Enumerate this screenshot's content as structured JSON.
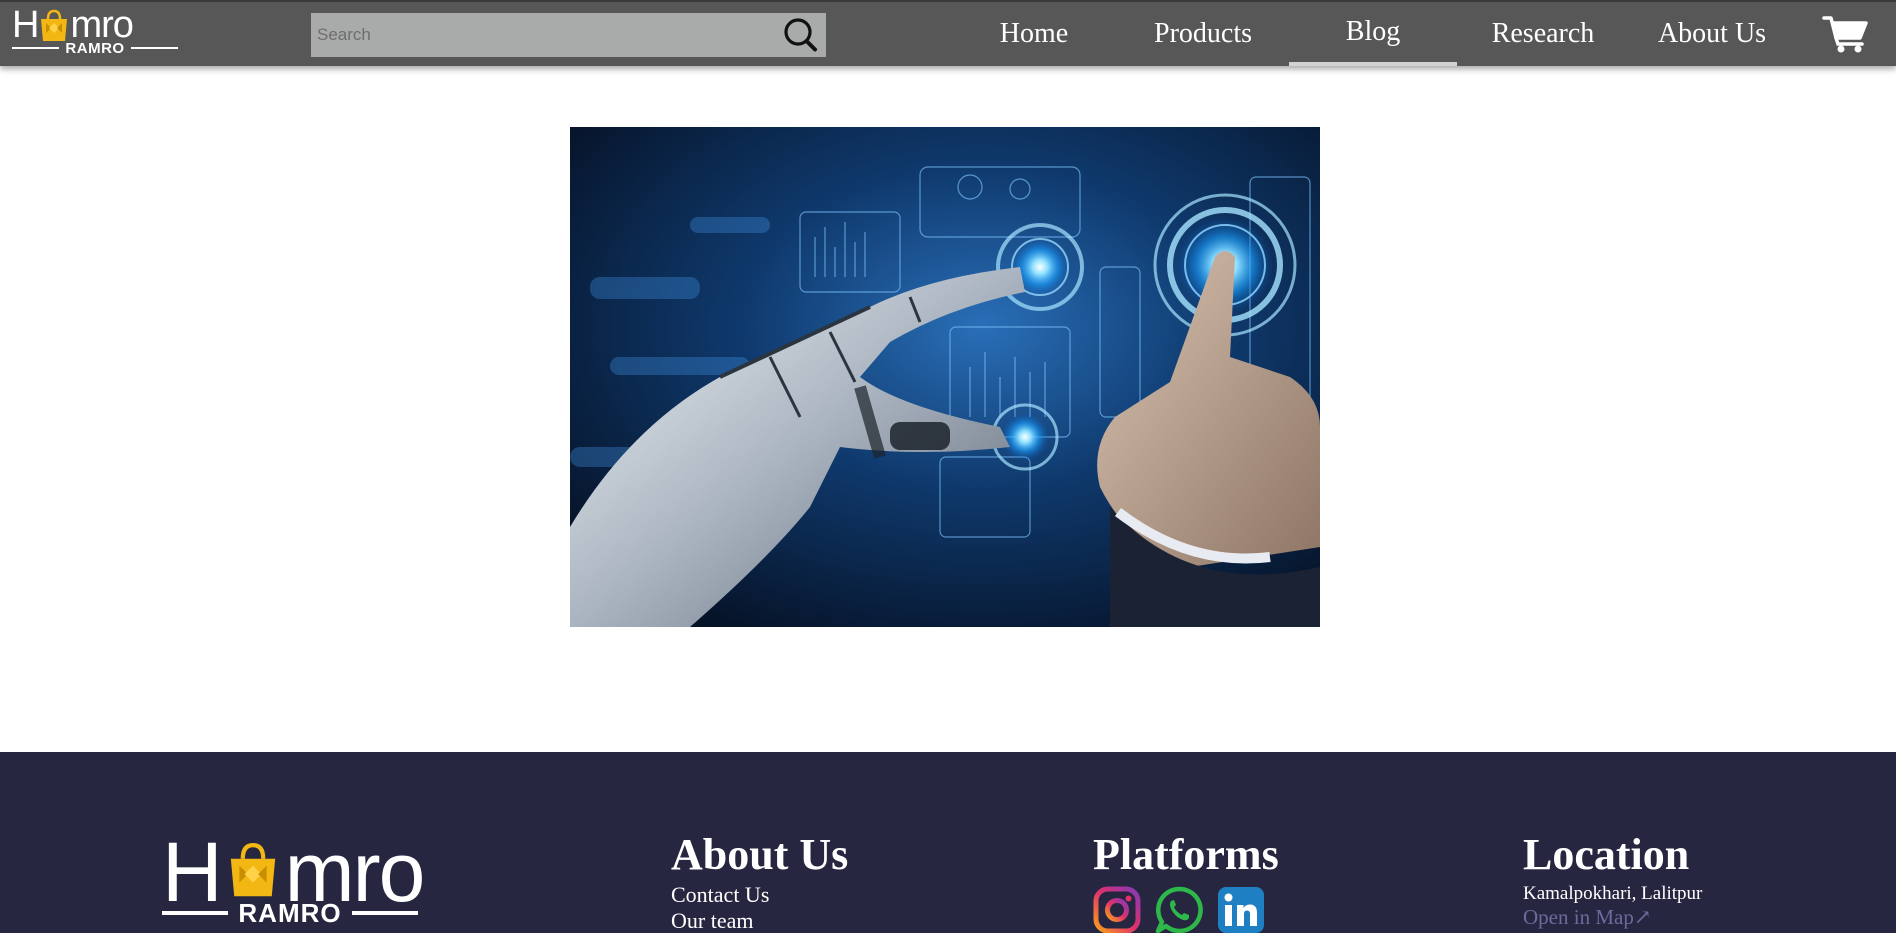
{
  "brand": {
    "logo_left": "H",
    "logo_right": "mro",
    "logo_sub": "RAMRO",
    "accent": "#f2b713"
  },
  "search": {
    "placeholder": "Search",
    "value": "",
    "icon": "search-icon"
  },
  "nav": {
    "items": [
      {
        "label": "Home"
      },
      {
        "label": "Products"
      },
      {
        "label": "Blog",
        "active": true
      },
      {
        "label": "Research"
      },
      {
        "label": "About Us"
      }
    ],
    "cart_icon": "cart-icon"
  },
  "colors": {
    "header_bg": "#575757",
    "search_bg": "#a9aaaa",
    "footer_bg": "#262640",
    "link_muted": "#6d6a9c"
  },
  "hero": {
    "icon": "robot-hand-touching-human-hand-image"
  },
  "footer": {
    "about": {
      "heading": "About Us",
      "links": [
        "Contact Us",
        "Our team"
      ]
    },
    "platforms": {
      "heading": "Platforms",
      "icons": [
        "instagram-icon",
        "whatsapp-icon",
        "linkedin-icon"
      ]
    },
    "location": {
      "heading": "Location",
      "address": "Kamalpokhari, Lalitpur",
      "map_link": "Open in Map↗"
    }
  }
}
